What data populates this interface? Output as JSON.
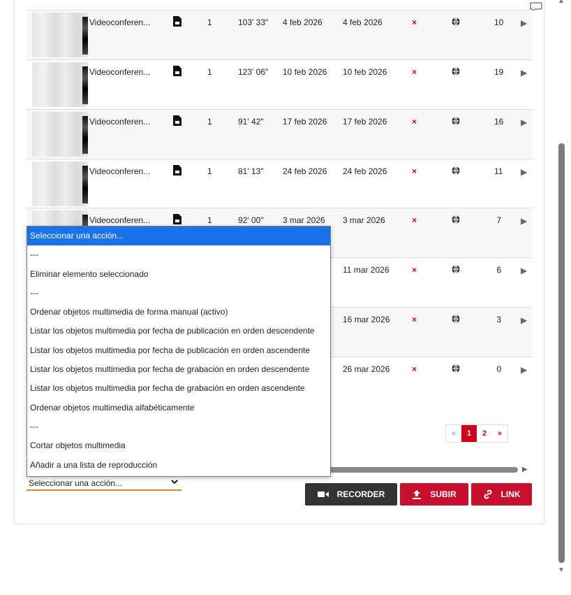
{
  "rows": [
    {
      "title": "Videoconferen...",
      "num": "1",
      "duration": "103' 33\"",
      "published": "4 feb 2026",
      "recorded": "4 feb 2026",
      "status": "×",
      "views": "10",
      "play": "▶"
    },
    {
      "title": "Videoconferen...",
      "num": "1",
      "duration": "123' 06\"",
      "published": "10 feb 2026",
      "recorded": "10 feb 2026",
      "status": "×",
      "views": "19",
      "play": "▶"
    },
    {
      "title": "Videoconferen...",
      "num": "1",
      "duration": "91' 42\"",
      "published": "17 feb 2026",
      "recorded": "17 feb 2026",
      "status": "×",
      "views": "16",
      "play": "▶"
    },
    {
      "title": "Videoconferen...",
      "num": "1",
      "duration": "81' 13\"",
      "published": "24 feb 2026",
      "recorded": "24 feb 2026",
      "status": "×",
      "views": "11",
      "play": "▶"
    },
    {
      "title": "Videoconferen...",
      "num": "1",
      "duration": "92' 00\"",
      "published": "3 mar 2026",
      "recorded": "3 mar 2026",
      "status": "×",
      "views": "7",
      "play": "▶"
    },
    {
      "recorded": "11 mar 2026",
      "status": "×",
      "views": "6",
      "play": "▶"
    },
    {
      "recorded": "16 mar 2026",
      "status": "×",
      "views": "3",
      "play": "▶"
    },
    {
      "recorded": "26 mar 2026",
      "status": "×",
      "views": "0",
      "play": "▶"
    }
  ],
  "dropdown": {
    "options": [
      "Seleccionar una acción...",
      "---",
      "Eliminar elemento seleccionado",
      "---",
      "Ordenar objetos multimedia de forma manual (activo)",
      "Listar los objetos multimedia por fecha de publicación en orden descendente",
      "Listar los objetos multimedia por fecha de publicación en orden ascendente",
      "Listar los objetos multimedia por fecha de grabación en orden descendente",
      "Listar los objetos multimedia por fecha de grabación en orden ascendente",
      "Ordenar objetos multimedia alfabéticamente",
      "---",
      "Cortar objetos multimedia",
      "Añadir a una lista de reproducción"
    ],
    "selected": "Seleccionar una acción..."
  },
  "pagination": {
    "prev": "«",
    "current": "1",
    "next_page": "2",
    "next": "»"
  },
  "buttons": {
    "recorder": "RECORDER",
    "upload": "SUBIR",
    "link": "LINK"
  },
  "colors": {
    "accent": "#c8102e",
    "selection": "#1a73e8",
    "select_underline": "#e8850c"
  }
}
